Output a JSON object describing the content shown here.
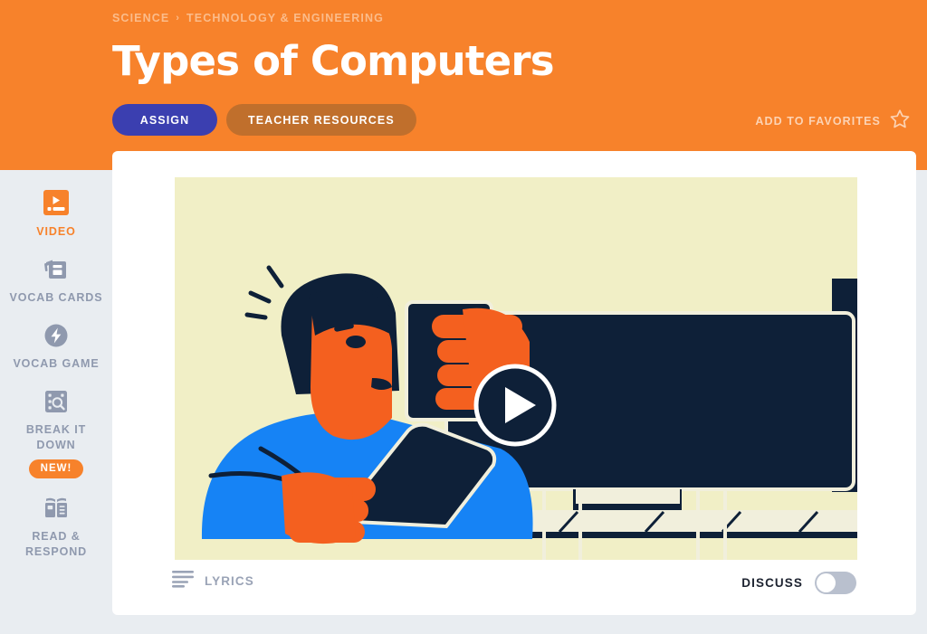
{
  "header": {
    "breadcrumb": [
      "SCIENCE",
      "TECHNOLOGY & ENGINEERING"
    ],
    "breadcrumb_separator": "›",
    "title": "Types of Computers",
    "assign_label": "ASSIGN",
    "teacher_resources_label": "TEACHER RESOURCES",
    "favorites_label": "ADD TO FAVORITES",
    "favorites_icon": "star-outline-icon",
    "background_color": "#f7822b",
    "assign_color": "#3b3fb0",
    "teacher_resources_color": "#c06f2c"
  },
  "sidebar": {
    "items": [
      {
        "label": "VIDEO",
        "icon": "video-icon",
        "active": true,
        "badge": null
      },
      {
        "label": "VOCAB CARDS",
        "icon": "vocab-cards-icon",
        "active": false,
        "badge": null
      },
      {
        "label": "VOCAB GAME",
        "icon": "vocab-game-bolt-icon",
        "active": false,
        "badge": null
      },
      {
        "label": "BREAK IT DOWN",
        "icon": "break-it-down-icon",
        "active": false,
        "badge": "NEW!"
      },
      {
        "label": "READ & RESPOND",
        "icon": "open-book-icon",
        "active": false,
        "badge": null
      }
    ],
    "active_color": "#f7822b",
    "inactive_color": "#8f99ae"
  },
  "main": {
    "video": {
      "play_button_icon": "play-icon",
      "stage_background": "#f1efc6",
      "illustration_colors": {
        "navy": "#0e2038",
        "orange": "#f4601f",
        "blue": "#1683f5",
        "cream": "#f1efdc"
      }
    },
    "footer": {
      "lyrics_label": "LYRICS",
      "lyrics_icon": "lyrics-lines-icon",
      "discuss_label": "DISCUSS",
      "discuss_toggle_on": false
    }
  }
}
